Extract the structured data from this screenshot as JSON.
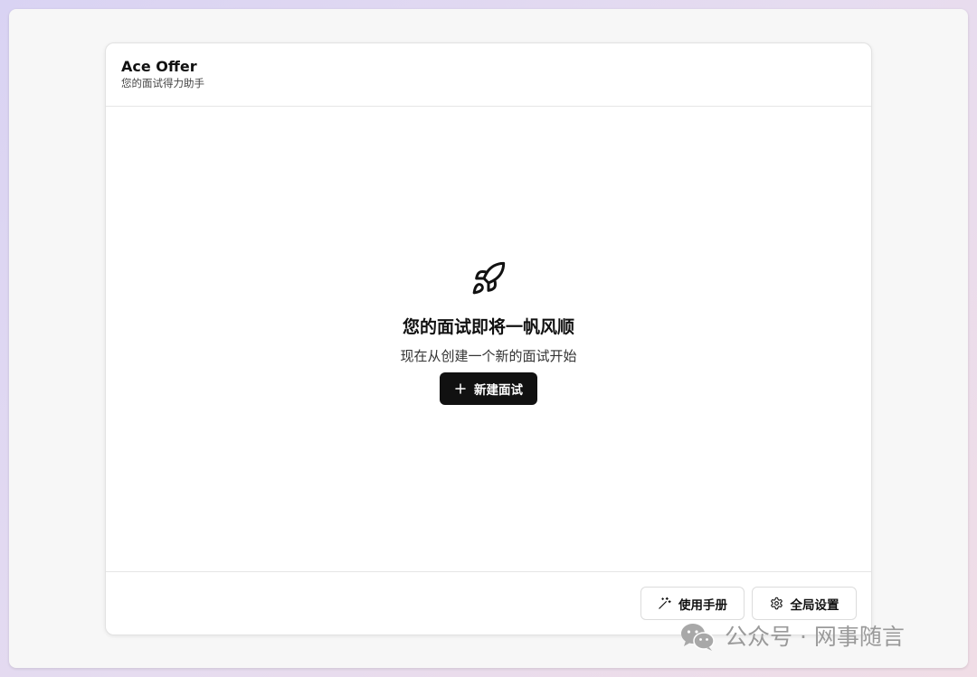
{
  "header": {
    "title": "Ace Offer",
    "subtitle": "您的面试得力助手"
  },
  "empty_state": {
    "icon": "rocket-icon",
    "title": "您的面试即将一帆风顺",
    "description": "现在从创建一个新的面试开始",
    "new_button_label": "新建面试",
    "new_button_icon": "plus-icon"
  },
  "footer": {
    "manual_label": "使用手册",
    "manual_icon": "magic-wand-icon",
    "settings_label": "全局设置",
    "settings_icon": "gear-icon"
  },
  "watermark": {
    "text": "公众号 · 网事随言",
    "icon": "wechat-icon"
  },
  "colors": {
    "primary_button_bg": "#111111",
    "card_bg": "#ffffff",
    "window_bg": "#f7f7f7",
    "border": "#e2e2e2"
  }
}
